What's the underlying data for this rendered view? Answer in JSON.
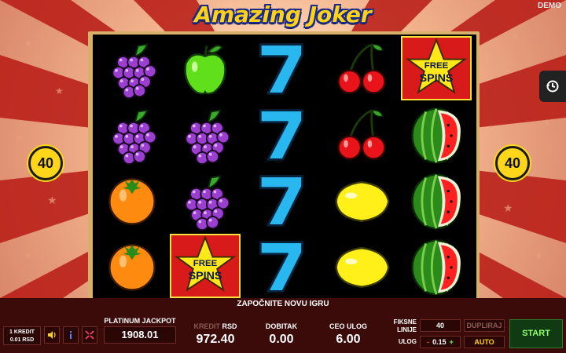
{
  "game": {
    "title": "Amazing Joker",
    "demo_label": "DEMO",
    "message": "ZAPOČNITE NOVU IGRU"
  },
  "lines": {
    "left": "40",
    "right": "40"
  },
  "reels": [
    [
      "grapes",
      "grapes",
      "orange",
      "orange"
    ],
    [
      "apple",
      "grapes",
      "grapes",
      "free-spins"
    ],
    [
      "seven",
      "seven",
      "seven",
      "seven"
    ],
    [
      "cherries",
      "cherries",
      "lemon",
      "lemon"
    ],
    [
      "free-spins",
      "watermelon",
      "watermelon",
      "watermelon"
    ]
  ],
  "free_spins_text": {
    "line1": "FREE",
    "line2": "SPINS"
  },
  "panel": {
    "credit_line1": "1 KREDIT",
    "credit_line2": "0.01 RSD",
    "jackpot_label": "PLATINUM JACKPOT",
    "jackpot_value": "1908.01",
    "balance_label_dim": "KREDIT",
    "balance_label": "RSD",
    "balance_value": "972.40",
    "win_label": "DOBITAK",
    "win_value": "0.00",
    "bet_label": "CEO ULOG",
    "bet_value": "6.00",
    "fixed_lines_label_1": "Fiksne",
    "fixed_lines_label_2": "linije",
    "fixed_lines_value": "40",
    "stake_label": "Ulog",
    "stake_minus": "-",
    "stake_value": "0.15",
    "stake_plus": "+",
    "double_label": "DUPLIRAJ",
    "auto_label": "AUTO",
    "start_label": "START"
  },
  "icons": {
    "sound": "speaker-icon",
    "info": "info-icon",
    "fullscreen": "expand-icon",
    "history": "history-icon"
  },
  "colors": {
    "reel_bg": "#000000",
    "seven_blue": "#28b8ef",
    "badge_yellow": "#ffd61a",
    "start_green": "#8eff6a"
  }
}
